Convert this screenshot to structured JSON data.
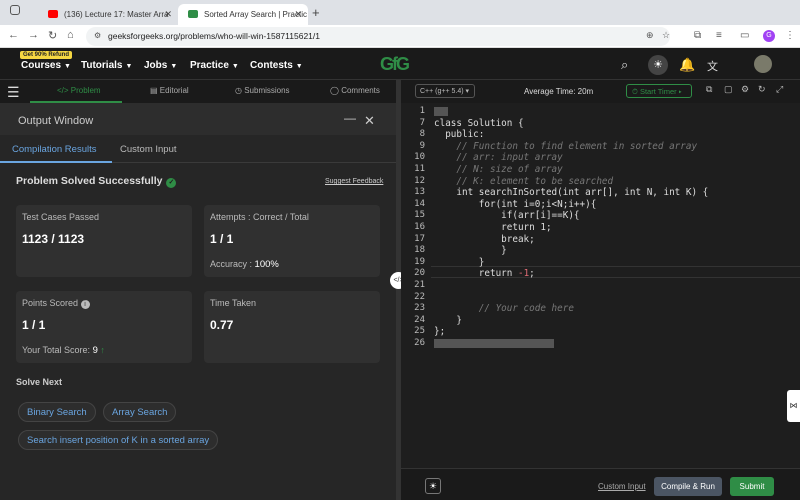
{
  "browser": {
    "tabs": [
      {
        "title": "(136) Lecture 17: Master Arra",
        "favicon_color": "#ff0000"
      },
      {
        "title": "Sorted Array Search | Practic",
        "favicon_color": "#2f8d46"
      }
    ],
    "url": "geeksforgeeks.org/problems/who-will-win-1587115621/1",
    "profile_initial": "G"
  },
  "gfg_nav": {
    "badge": "Get 90% Refund",
    "items": [
      "Courses",
      "Tutorials",
      "Jobs",
      "Practice",
      "Contests"
    ],
    "logo": "GfG"
  },
  "problem_tabs": [
    "Problem",
    "Editorial",
    "Submissions",
    "Comments"
  ],
  "output": {
    "title": "Output Window",
    "tabs": [
      "Compilation Results",
      "Custom Input"
    ],
    "status": "Problem Solved Successfully",
    "suggest_feedback": "Suggest Feedback",
    "cards": {
      "test_cases_label": "Test Cases Passed",
      "test_cases_value": "1123 / 1123",
      "attempts_label": "Attempts : Correct / Total",
      "attempts_value": "1 / 1",
      "accuracy_label": "Accuracy :",
      "accuracy_value": "100%",
      "points_label": "Points Scored",
      "points_value": "1 / 1",
      "total_score_label": "Your Total Score:",
      "total_score_value": "9",
      "time_label": "Time Taken",
      "time_value": "0.77"
    },
    "solve_next_label": "Solve Next",
    "solve_next": [
      "Binary Search",
      "Array Search",
      "Search insert position of K in a sorted array"
    ]
  },
  "editor": {
    "language": "C++ (g++ 5.4)",
    "average_time": "Average Time: 20m",
    "start_timer": "Start Timer",
    "lines": [
      {
        "n": "1",
        "text": ""
      },
      {
        "n": "7",
        "text": "class Solution {"
      },
      {
        "n": "8",
        "text": "  public:"
      },
      {
        "n": "9",
        "text": "    // Function to find element in sorted array"
      },
      {
        "n": "10",
        "text": "    // arr: input array"
      },
      {
        "n": "11",
        "text": "    // N: size of array"
      },
      {
        "n": "12",
        "text": "    // K: element to be searched"
      },
      {
        "n": "13",
        "text": "    int searchInSorted(int arr[], int N, int K) {"
      },
      {
        "n": "14",
        "text": "        for(int i=0;i<N;i++){"
      },
      {
        "n": "15",
        "text": "            if(arr[i]==K){"
      },
      {
        "n": "16",
        "text": "            return 1;"
      },
      {
        "n": "17",
        "text": "            break;"
      },
      {
        "n": "18",
        "text": "            }"
      },
      {
        "n": "19",
        "text": "        }"
      },
      {
        "n": "20",
        "text": "        return -1;"
      },
      {
        "n": "21",
        "text": ""
      },
      {
        "n": "22",
        "text": ""
      },
      {
        "n": "23",
        "text": "        // Your code here"
      },
      {
        "n": "24",
        "text": "    }"
      },
      {
        "n": "25",
        "text": "};"
      },
      {
        "n": "26",
        "text": ""
      }
    ],
    "custom_input": "Custom Input",
    "compile_run": "Compile & Run",
    "submit": "Submit"
  }
}
